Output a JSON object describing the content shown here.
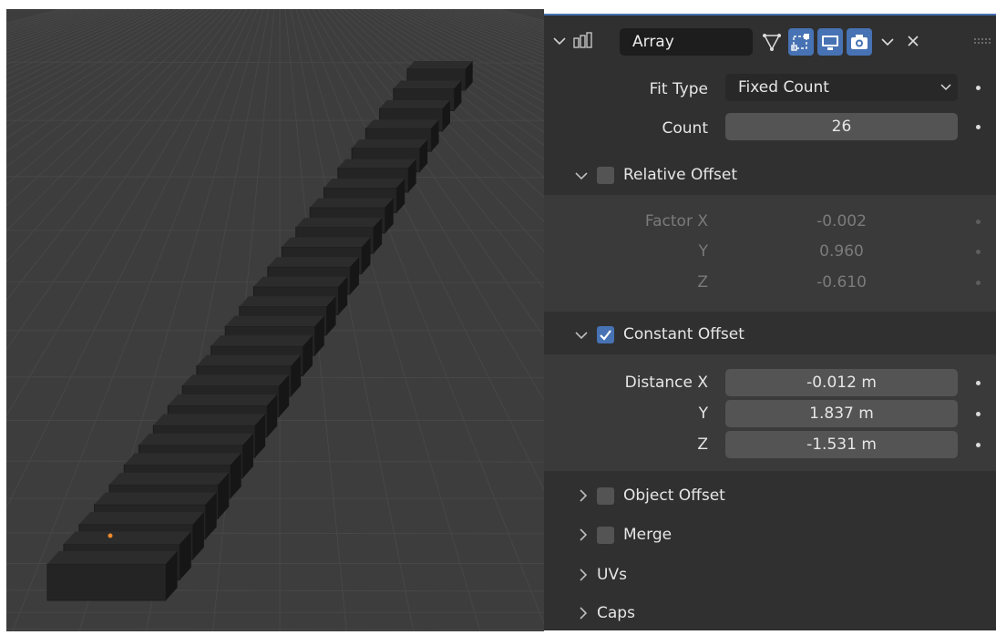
{
  "modifier": {
    "name": "Array",
    "header_icons": [
      "array-modifier-icon",
      "edit-mode-icon",
      "cage-icon",
      "viewport-display-icon",
      "render-camera-icon",
      "dropdown-chevron-icon",
      "close-icon"
    ]
  },
  "fit_type": {
    "label": "Fit Type",
    "value": "Fixed Count"
  },
  "count": {
    "label": "Count",
    "value": "26"
  },
  "relative_offset": {
    "title": "Relative Offset",
    "enabled": false,
    "rows": [
      {
        "label": "Factor X",
        "value": "-0.002"
      },
      {
        "label": "Y",
        "value": "0.960"
      },
      {
        "label": "Z",
        "value": "-0.610"
      }
    ]
  },
  "constant_offset": {
    "title": "Constant Offset",
    "enabled": true,
    "rows": [
      {
        "label": "Distance X",
        "value": "-0.012 m"
      },
      {
        "label": "Y",
        "value": "1.837 m"
      },
      {
        "label": "Z",
        "value": "-1.531 m"
      }
    ]
  },
  "collapsed_panels": {
    "object_offset": "Object Offset",
    "merge": "Merge",
    "uvs": "UVs",
    "caps": "Caps"
  },
  "colors": {
    "accent": "#4772b3",
    "panel_bg": "#303030",
    "viewport_bg": "#3d3d3d",
    "origin_dot": "#f08a2a"
  },
  "viewport": {
    "step_count": 26
  }
}
